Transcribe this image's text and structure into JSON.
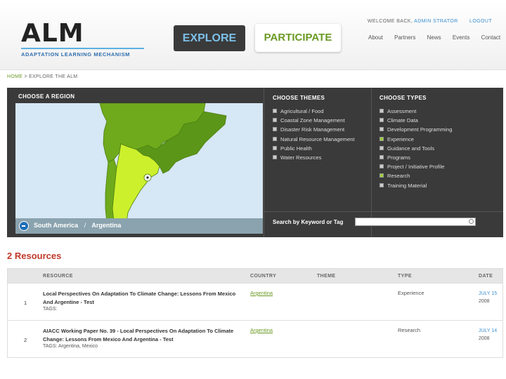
{
  "header": {
    "logo_main": "ALM",
    "logo_sub": "ADAPTATION LEARNING MECHANISM",
    "explore_label": "EXPLORE",
    "participate_label": "PARTICIPATE",
    "welcome_prefix": "WELCOME BACK,",
    "username": "ADMIN STRATOR",
    "logout_label": "LOGOUT",
    "nav": [
      "About",
      "Partners",
      "News",
      "Events",
      "Contact"
    ]
  },
  "breadcrumb": {
    "home": "HOME",
    "sep": ">",
    "current": "EXPLORE THE ALM"
  },
  "region": {
    "title": "CHOOSE A REGION",
    "selected_region": "South America",
    "separator": "/",
    "selected_country": "Argentina"
  },
  "themes": {
    "title": "CHOOSE THEMES",
    "items": [
      {
        "label": "Agricultural / Food",
        "checked": false
      },
      {
        "label": "Coastal Zone Management",
        "checked": false
      },
      {
        "label": "Disaster Risk Management",
        "checked": false
      },
      {
        "label": "Natural Resource Management",
        "checked": false
      },
      {
        "label": "Public Health",
        "checked": false
      },
      {
        "label": "Water Resources",
        "checked": false
      }
    ]
  },
  "types": {
    "title": "CHOOSE TYPES",
    "items": [
      {
        "label": "Assessment",
        "checked": false
      },
      {
        "label": "Climate Data",
        "checked": false
      },
      {
        "label": "Development Programming",
        "checked": false
      },
      {
        "label": "Experience",
        "checked": true
      },
      {
        "label": "Guidance and Tools",
        "checked": false
      },
      {
        "label": "Programs",
        "checked": false
      },
      {
        "label": "Project / Initiative Profile",
        "checked": false
      },
      {
        "label": "Research",
        "checked": true
      },
      {
        "label": "Training Material",
        "checked": false
      }
    ]
  },
  "search": {
    "label": "Search by Keyword or Tag",
    "value": "",
    "placeholder": ""
  },
  "resources": {
    "count_label": "2 Resources",
    "columns": [
      "RESOURCE",
      "COUNTRY",
      "THEME",
      "TYPE",
      "DATE"
    ],
    "rows": [
      {
        "num": "1",
        "title": "Local Perspectives On Adaptation To Climate Change: Lessons From Mexico And Argentine - Test",
        "tags": "TAGS:",
        "country": "Argentina",
        "theme": "",
        "type": "Experience",
        "date_month": "JULY 15",
        "date_year": "2008"
      },
      {
        "num": "2",
        "title": "AIACC Working Paper No. 39 - Local Perspectives On Adaptation To Climate Change: Lessons From Mexico And Argentina - Test",
        "tags": "TAGS: Argentina, Mexico",
        "country": "Argentina",
        "theme": "",
        "type": "Research",
        "date_month": "JULY 14",
        "date_year": "2008"
      }
    ]
  },
  "colors": {
    "accent_blue": "#3a8fcf",
    "accent_green": "#6a9a24",
    "panel_bg": "#3a3a3a",
    "resources_red": "#c0392b",
    "map_land": "#6faa1c",
    "map_selected": "#ccf02c",
    "map_sea": "#d6e7f5"
  }
}
